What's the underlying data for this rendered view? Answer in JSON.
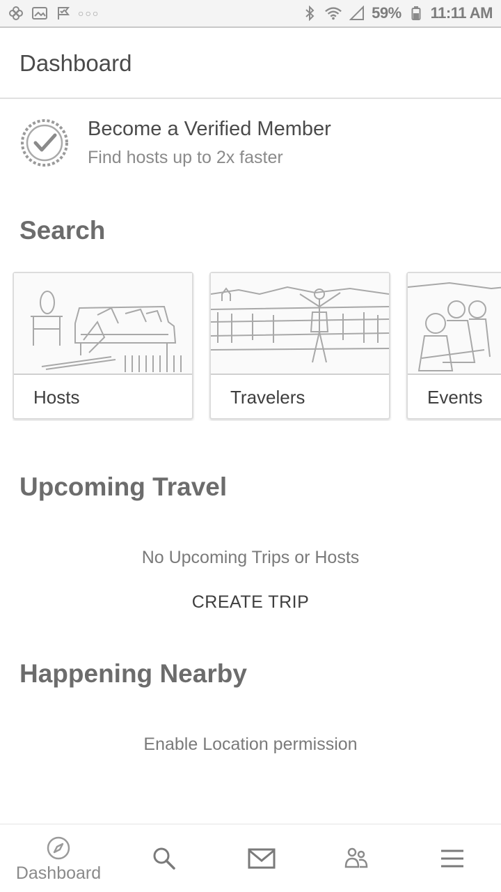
{
  "status_bar": {
    "battery": "59%",
    "time": "11:11 AM",
    "left_icons": [
      "pinwheel-icon",
      "image-icon",
      "check-flag-icon",
      "more-dots-icon"
    ],
    "right_icons": [
      "bluetooth-icon",
      "wifi-icon",
      "signal-icon",
      "battery-icon"
    ]
  },
  "app_bar": {
    "title": "Dashboard"
  },
  "verified": {
    "title": "Become a Verified Member",
    "subtitle": "Find hosts up to 2x faster",
    "icon": "verified-badge-icon"
  },
  "search": {
    "heading": "Search",
    "cards": [
      {
        "label": "Hosts",
        "icon": "living-room-photo"
      },
      {
        "label": "Travelers",
        "icon": "traveler-photo"
      },
      {
        "label": "Events",
        "icon": "event-photo"
      }
    ]
  },
  "upcoming": {
    "heading": "Upcoming Travel",
    "empty_message": "No Upcoming Trips or Hosts",
    "action": "CREATE TRIP"
  },
  "nearby": {
    "heading": "Happening Nearby",
    "message": "Enable Location permission"
  },
  "bottom_nav": {
    "items": [
      {
        "label": "Dashboard",
        "icon": "compass-icon",
        "selected": true
      },
      {
        "label": "",
        "icon": "search-icon"
      },
      {
        "label": "",
        "icon": "mail-icon"
      },
      {
        "label": "",
        "icon": "people-icon"
      },
      {
        "label": "",
        "icon": "menu-icon"
      }
    ]
  },
  "colors": {
    "text": "#3a3a3a",
    "muted": "#8a8a8a",
    "divider": "#e0e0e0"
  }
}
